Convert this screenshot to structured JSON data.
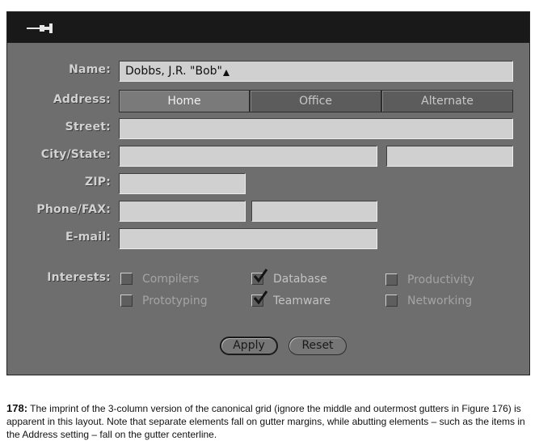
{
  "window": {
    "pin_icon": "pushpin-icon",
    "colors": {
      "background": "#6e6e6e",
      "titlebar": "#191919",
      "field": "#d0d0d0",
      "label": "#d2d2d2"
    }
  },
  "form": {
    "name": {
      "label": "Name:",
      "value": "Dobbs, J.R. \"Bob\""
    },
    "address": {
      "label": "Address:",
      "options": [
        "Home",
        "Office",
        "Alternate"
      ],
      "selected": "Home"
    },
    "street": {
      "label": "Street:",
      "value": ""
    },
    "city_state": {
      "label": "City/State:",
      "city": "",
      "state": ""
    },
    "zip": {
      "label": "ZIP:",
      "value": ""
    },
    "phone_fax": {
      "label": "Phone/FAX:",
      "phone": "",
      "fax": ""
    },
    "email": {
      "label": "E-mail:",
      "value": ""
    },
    "interests": {
      "label": "Interests:",
      "items": [
        {
          "label": "Compilers",
          "checked": false
        },
        {
          "label": "Database",
          "checked": true
        },
        {
          "label": "Productivity",
          "checked": false
        },
        {
          "label": "Prototyping",
          "checked": false
        },
        {
          "label": "Teamware",
          "checked": true
        },
        {
          "label": "Networking",
          "checked": false
        }
      ]
    },
    "buttons": {
      "apply": "Apply",
      "reset": "Reset"
    }
  },
  "caption": {
    "number": "178:",
    "text": " The imprint of the 3-column version of the canonical grid (ignore the middle and outermost gutters in Figure 176) is apparent in this layout. Note that separate elements fall on gutter margins, while abutting elements – such as the items in the Address setting – fall on the gutter centerline."
  }
}
